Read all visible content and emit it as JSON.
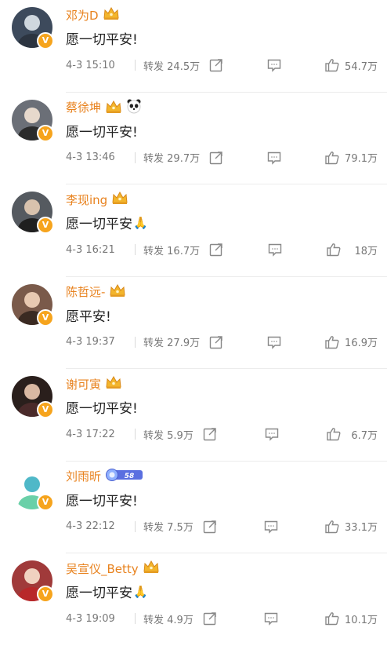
{
  "labels": {
    "repost": "转发"
  },
  "colors": {
    "name": "#e8821e",
    "badge": "#f6a41d",
    "meta": "#777777"
  },
  "posts": [
    {
      "name": "邓为D",
      "content": "愿一切平安!",
      "time": "4-3 15:10",
      "reposts": "24.5万",
      "likes": "54.7万",
      "badges": [
        "crown"
      ],
      "emoji": ""
    },
    {
      "name": "蔡徐坤",
      "content": "愿一切平安!",
      "time": "4-3 13:46",
      "reposts": "29.7万",
      "likes": "79.1万",
      "badges": [
        "crown",
        "panda"
      ],
      "emoji": ""
    },
    {
      "name": "李现ing",
      "content": "愿一切平安",
      "time": "4-3 16:21",
      "reposts": "16.7万",
      "likes": "18万",
      "badges": [
        "crown"
      ],
      "emoji": "🙏"
    },
    {
      "name": "陈哲远-",
      "content": "愿平安!",
      "time": "4-3 19:37",
      "reposts": "27.9万",
      "likes": "16.9万",
      "badges": [
        "crown"
      ],
      "emoji": ""
    },
    {
      "name": "谢可寅",
      "content": "愿一切平安!",
      "time": "4-3 17:22",
      "reposts": "5.9万",
      "likes": "6.7万",
      "badges": [
        "crown"
      ],
      "emoji": ""
    },
    {
      "name": "刘雨昕",
      "content": "愿一切平安!",
      "time": "4-3 22:12",
      "reposts": "7.5万",
      "likes": "33.1万",
      "badges": [
        "medal"
      ],
      "medal_text": "58",
      "emoji": ""
    },
    {
      "name": "吴宣仪_Betty",
      "content": "愿一切平安",
      "time": "4-3 19:09",
      "reposts": "4.9万",
      "likes": "10.1万",
      "badges": [
        "crown"
      ],
      "emoji": "🙏"
    }
  ]
}
